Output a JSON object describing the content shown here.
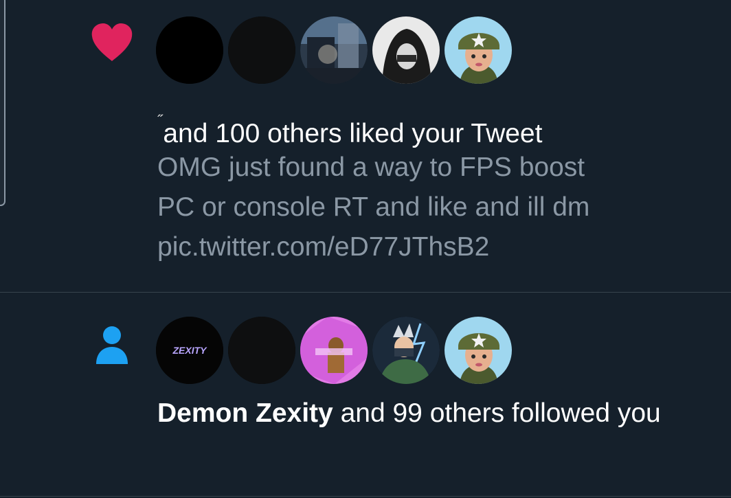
{
  "colors": {
    "background": "#15202b",
    "divider": "#38444d",
    "heart": "#e0245e",
    "follow_icon": "#1da1f2",
    "primary_text": "#ffffff",
    "secondary_text": "#8b98a5"
  },
  "notifications": [
    {
      "type": "like",
      "icon": "heart-icon",
      "avatars": [
        "avatar-black",
        "avatar-dark",
        "avatar-blurry-photo",
        "avatar-hooded-figure",
        "avatar-soldier-character"
      ],
      "headline": {
        "tick": "˝",
        "text": "and 100 others liked your Tweet"
      },
      "tweet_lines": [
        "OMG just found a way to FPS boost",
        "PC or console RT and like and ill dm",
        "pic.twitter.com/eD77JThsB2"
      ]
    },
    {
      "type": "follow",
      "icon": "person-icon",
      "avatars": [
        "avatar-zexity-logo",
        "avatar-dark",
        "avatar-pink-art",
        "avatar-anime-ninja",
        "avatar-soldier-character"
      ],
      "avatar_logo_text": "ZEXITY",
      "headline": {
        "name": "Demon Zexity",
        "text": " and 99 others followed you"
      }
    }
  ]
}
